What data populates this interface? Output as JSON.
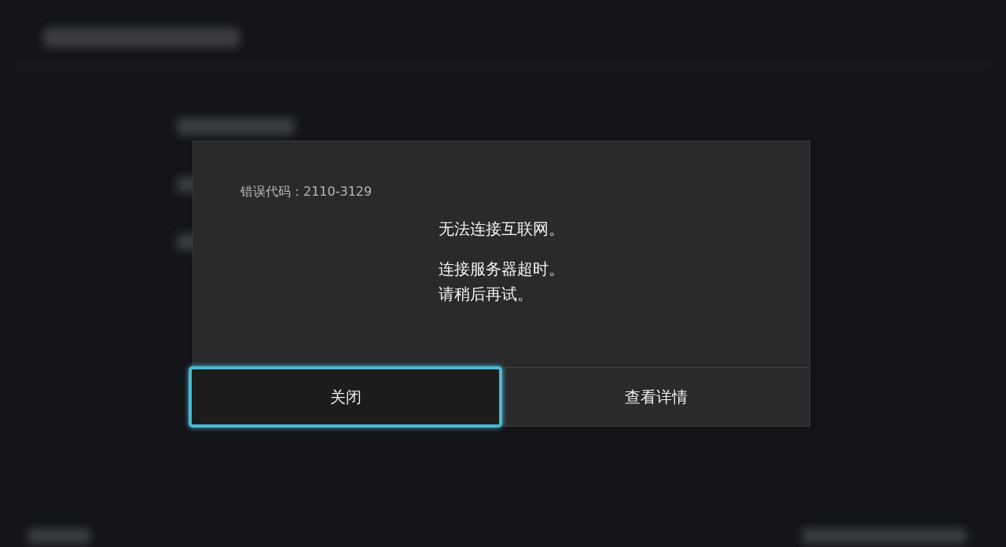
{
  "dialog": {
    "error_code": "错误代码：2110-3129",
    "title": "无法连接互联网。",
    "message_lines": [
      "连接服务器超时。",
      "请稍后再试。"
    ],
    "buttons": [
      {
        "label": "关闭",
        "selected": true
      },
      {
        "label": "查看详情",
        "selected": false
      }
    ]
  }
}
